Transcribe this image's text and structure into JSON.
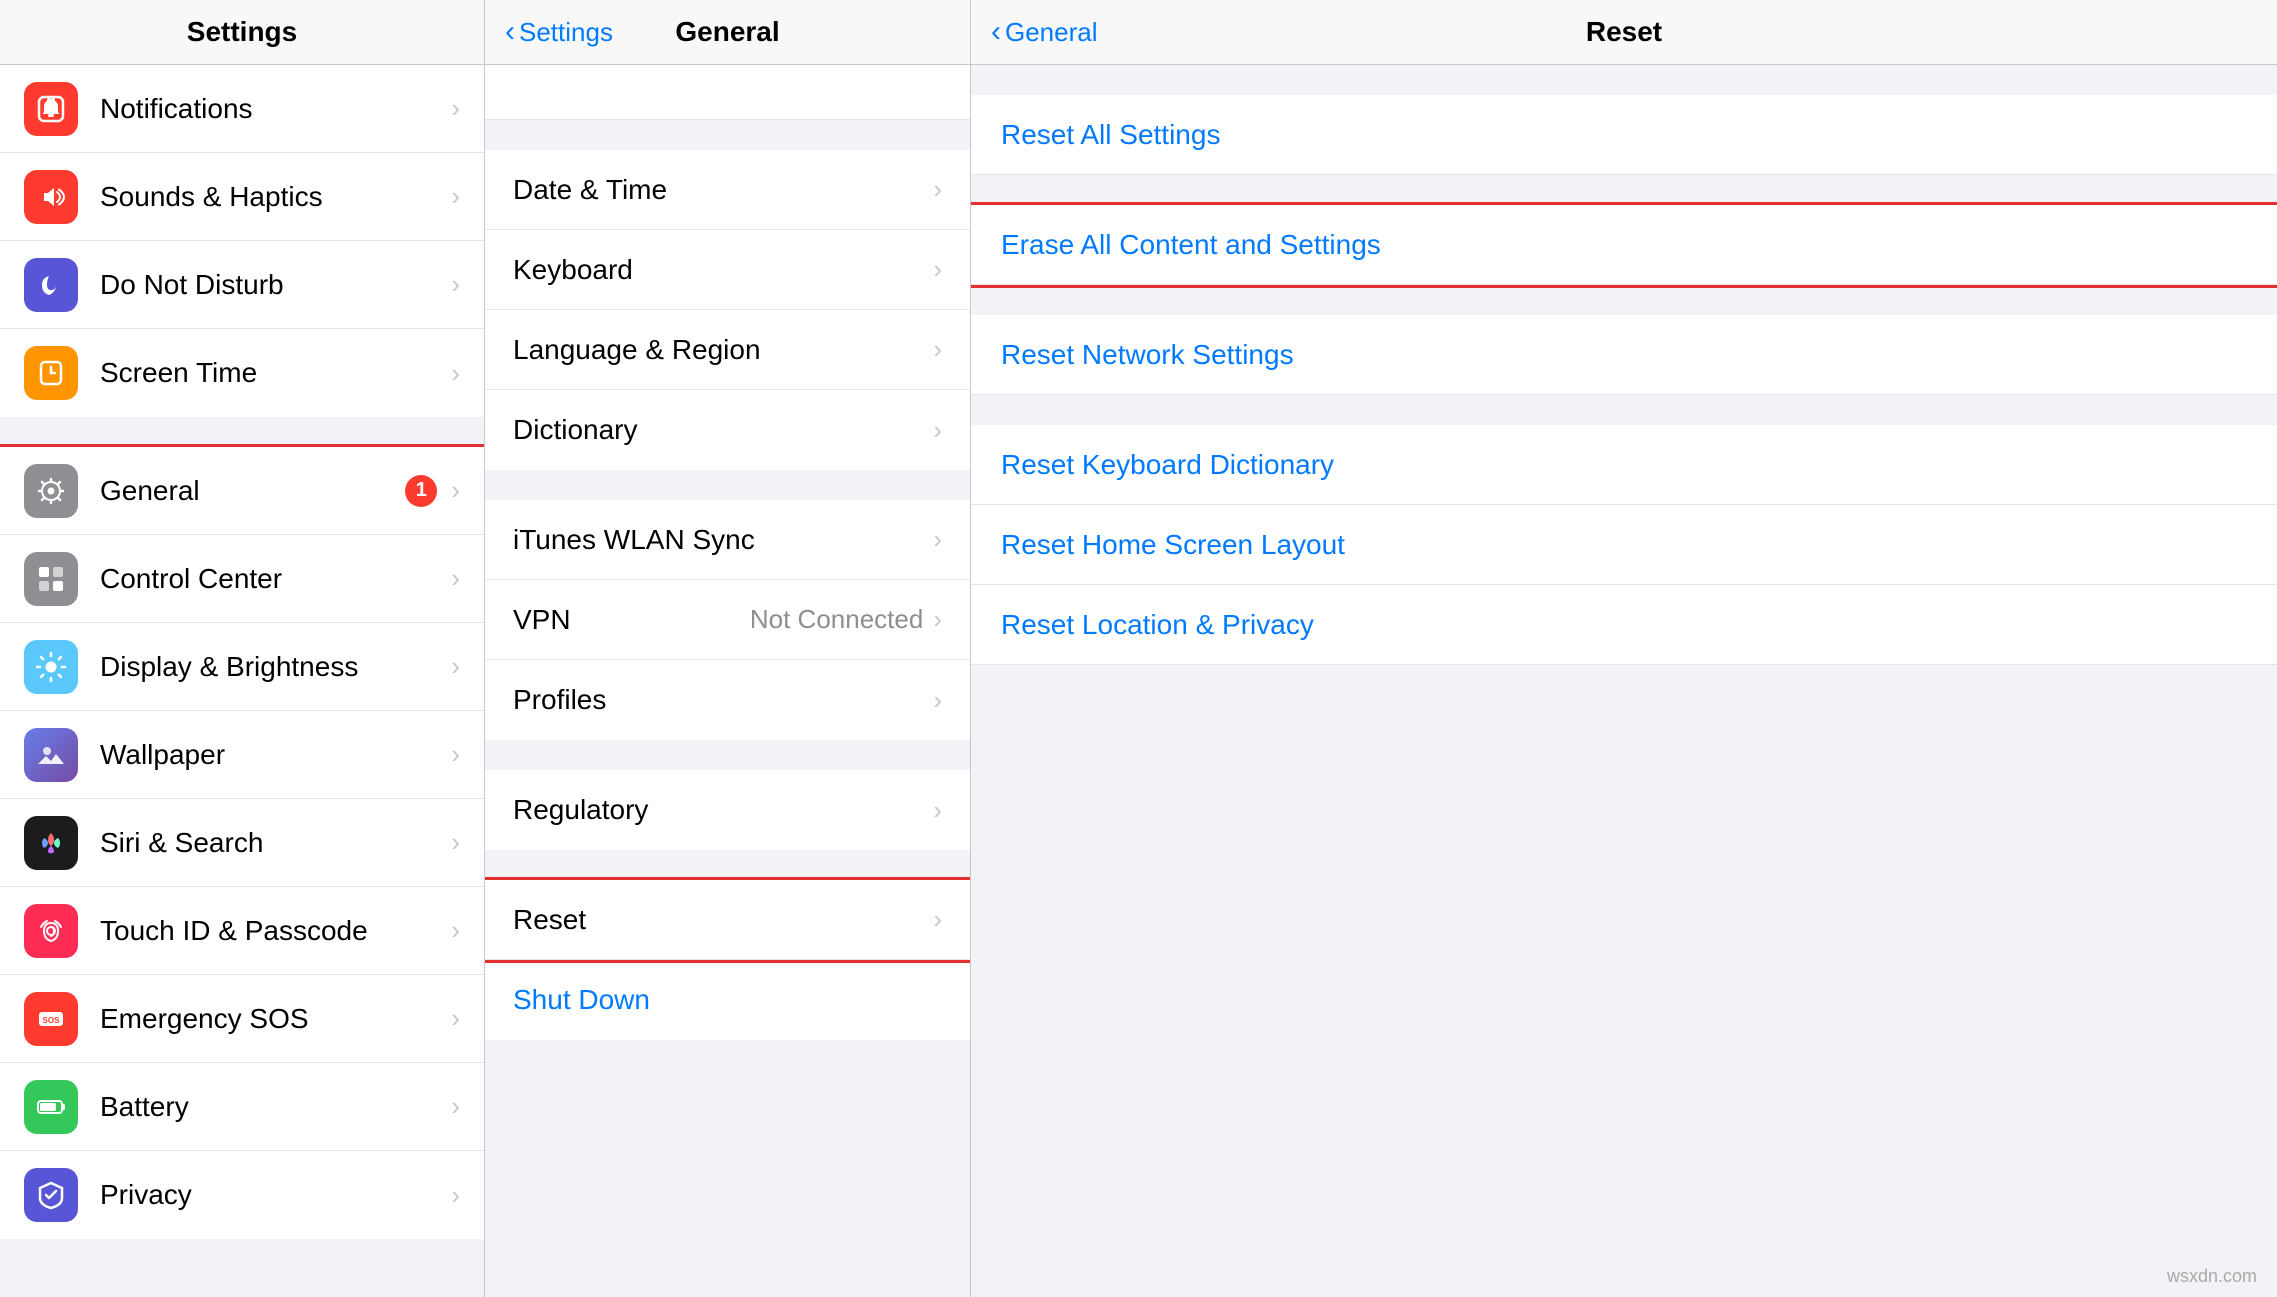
{
  "columns": {
    "left": {
      "title": "Settings",
      "items_group1": [
        {
          "id": "notifications",
          "label": "Notifications",
          "icon_bg": "icon-red",
          "icon": "bell"
        },
        {
          "id": "sounds",
          "label": "Sounds & Haptics",
          "icon_bg": "icon-red",
          "icon": "speaker"
        },
        {
          "id": "donotdisturb",
          "label": "Do Not Disturb",
          "icon_bg": "icon-indigo",
          "icon": "moon"
        },
        {
          "id": "screentime",
          "label": "Screen Time",
          "icon_bg": "icon-orange",
          "icon": "hourglass"
        }
      ],
      "items_group2": [
        {
          "id": "general",
          "label": "General",
          "icon_bg": "icon-gray",
          "icon": "gear",
          "badge": "1",
          "highlighted": true
        },
        {
          "id": "controlcenter",
          "label": "Control Center",
          "icon_bg": "icon-gray",
          "icon": "sliders"
        },
        {
          "id": "displaybrightness",
          "label": "Display & Brightness",
          "icon_bg": "icon-blue-gray",
          "icon": "display"
        },
        {
          "id": "wallpaper",
          "label": "Wallpaper",
          "icon_bg": "icon-teal",
          "icon": "wallpaper"
        },
        {
          "id": "siri",
          "label": "Siri & Search",
          "icon_bg": "icon-siri",
          "icon": "siri"
        },
        {
          "id": "touchid",
          "label": "Touch ID & Passcode",
          "icon_bg": "icon-pink",
          "icon": "fingerprint"
        },
        {
          "id": "emergencysos",
          "label": "Emergency SOS",
          "icon_bg": "icon-red",
          "icon": "sos"
        },
        {
          "id": "battery",
          "label": "Battery",
          "icon_bg": "icon-green",
          "icon": "battery"
        },
        {
          "id": "privacy",
          "label": "Privacy",
          "icon_bg": "icon-indigo",
          "icon": "hand"
        }
      ]
    },
    "middle": {
      "title": "General",
      "back_label": "Settings",
      "partial_top": true,
      "items_group1": [
        {
          "id": "datetime",
          "label": "Date & Time"
        },
        {
          "id": "keyboard",
          "label": "Keyboard"
        },
        {
          "id": "language",
          "label": "Language & Region"
        },
        {
          "id": "dictionary",
          "label": "Dictionary"
        }
      ],
      "items_group2": [
        {
          "id": "wlansync",
          "label": "iTunes WLAN Sync"
        },
        {
          "id": "vpn",
          "label": "VPN",
          "value": "Not Connected"
        },
        {
          "id": "profiles",
          "label": "Profiles"
        }
      ],
      "items_group3": [
        {
          "id": "regulatory",
          "label": "Regulatory"
        }
      ],
      "items_group4": [
        {
          "id": "reset",
          "label": "Reset",
          "highlighted": true
        },
        {
          "id": "shutdown",
          "label": "Shut Down",
          "blue": true
        }
      ]
    },
    "right": {
      "title": "Reset",
      "back_label": "General",
      "items_group1": [
        {
          "id": "reset-all-settings",
          "label": "Reset All Settings"
        }
      ],
      "items_group2": [
        {
          "id": "erase-all",
          "label": "Erase All Content and Settings",
          "highlighted": true
        }
      ],
      "items_group3": [
        {
          "id": "reset-network",
          "label": "Reset Network Settings"
        }
      ],
      "items_group4": [
        {
          "id": "reset-keyboard",
          "label": "Reset Keyboard Dictionary"
        },
        {
          "id": "reset-homescreen",
          "label": "Reset Home Screen Layout"
        },
        {
          "id": "reset-location",
          "label": "Reset Location & Privacy"
        }
      ]
    }
  },
  "watermark": "wsxdn.com"
}
